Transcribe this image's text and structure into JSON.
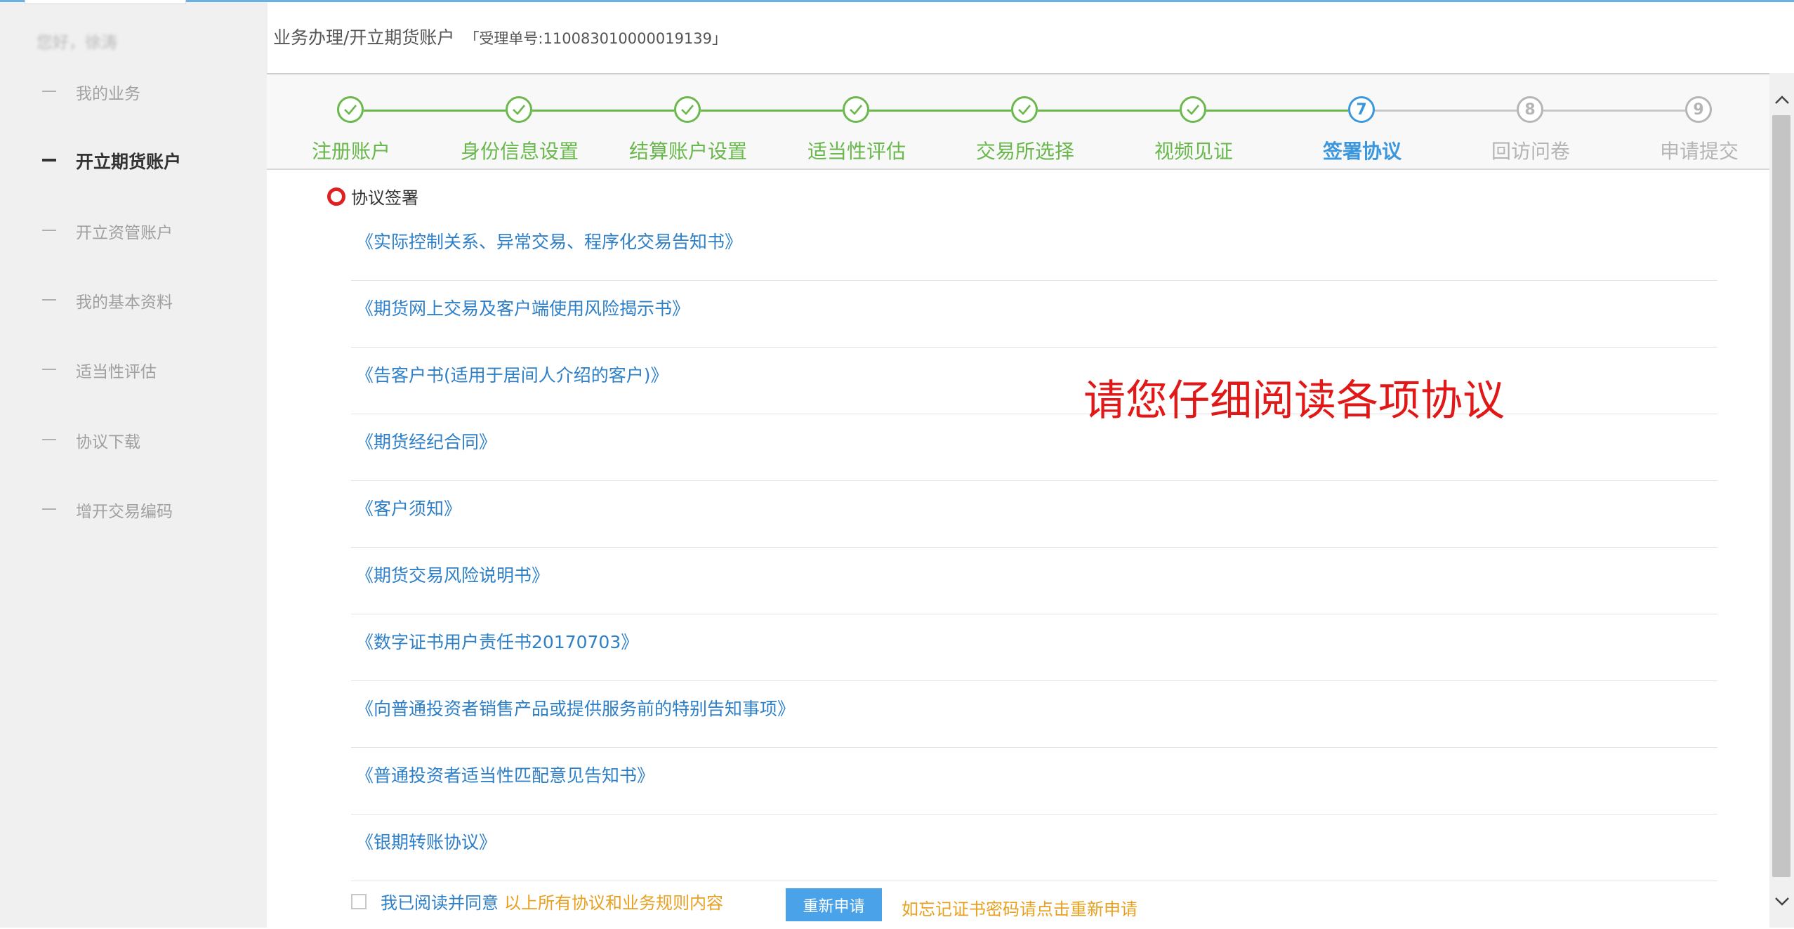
{
  "sidebar": {
    "greeting": "您好，徐涛",
    "items": [
      {
        "label": "我的业务",
        "active": false
      },
      {
        "label": "开立期货账户",
        "active": true
      },
      {
        "label": "开立资管账户",
        "active": false
      },
      {
        "label": "我的基本资料",
        "active": false
      },
      {
        "label": "适当性评估",
        "active": false
      },
      {
        "label": "协议下载",
        "active": false
      },
      {
        "label": "增开交易编码",
        "active": false
      }
    ]
  },
  "header": {
    "breadcrumb": "业务办理/开立期货账户",
    "ticket": "「受理单号:110083010000019139」"
  },
  "steps": [
    {
      "num": "1",
      "label": "注册账户",
      "status": "done"
    },
    {
      "num": "2",
      "label": "身份信息设置",
      "status": "done"
    },
    {
      "num": "3",
      "label": "结算账户设置",
      "status": "done"
    },
    {
      "num": "4",
      "label": "适当性评估",
      "status": "done"
    },
    {
      "num": "5",
      "label": "交易所选择",
      "status": "done"
    },
    {
      "num": "6",
      "label": "视频见证",
      "status": "done"
    },
    {
      "num": "7",
      "label": "签署协议",
      "status": "current"
    },
    {
      "num": "8",
      "label": "回访问卷",
      "status": "pending"
    },
    {
      "num": "9",
      "label": "申请提交",
      "status": "pending"
    }
  ],
  "section": {
    "title": "协议签署"
  },
  "agreements": [
    "《实际控制关系、异常交易、程序化交易告知书》",
    "《期货网上交易及客户端使用风险揭示书》",
    "《告客户书(适用于居间人介绍的客户)》",
    "《期货经纪合同》",
    "《客户须知》",
    "《期货交易风险说明书》",
    "《数字证书用户责任书20170703》",
    "《向普通投资者销售产品或提供服务前的特别告知事项》",
    "《普通投资者适当性匹配意见告知书》",
    "《银期转账协议》"
  ],
  "notice": "请您仔细阅读各项协议",
  "agree": {
    "text1": "我已阅读并同意",
    "text2": "以上所有协议和业务规则内容",
    "checked": false
  },
  "reapply": {
    "button": "重新申请",
    "hint": "如忘记证书密码请点击重新申请"
  },
  "colors": {
    "done": "#69b84b",
    "current": "#3b97dd",
    "pending": "#b5b5b5",
    "link": "#2d7fc7",
    "notice": "#e01818",
    "warning": "#e8a020",
    "button": "#4aa3e8"
  }
}
